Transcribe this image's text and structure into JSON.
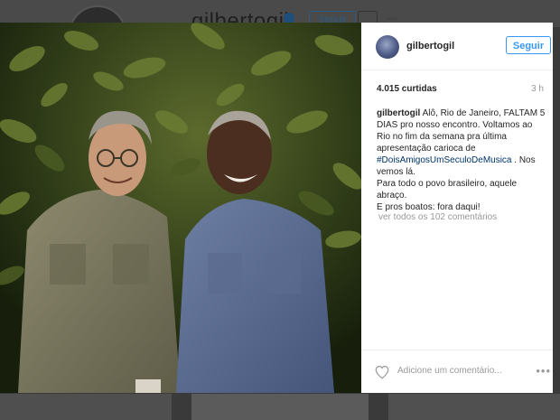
{
  "background": {
    "username": "gilbertogil",
    "follow_label": "Seguir",
    "more_dots": "•••"
  },
  "post": {
    "username": "gilbertogil",
    "follow_label": "Seguir",
    "likes": "4.015 curtidas",
    "time": "3 h",
    "caption": {
      "author": "gilbertogil",
      "text_before_tag": " Alô, Rio de Janeiro, FALTAM 5 DIAS pro nosso encontro. Voltamos ao Rio no fim da semana pra última apresentação carioca de ",
      "hashtag": "#DoisAmigosUmSeculoDeMusica",
      "text_after_tag": " . Nos vemos lá.",
      "line2": "Para todo o povo brasileiro, aquele abraço.",
      "line3": "E pros boatos: fora daqui!"
    },
    "view_all_comments": "ver todos os 102 comentários",
    "comment_placeholder": "Adicione um comentário...",
    "more_options": "•••"
  },
  "icons": {
    "verified": "verified-badge-icon",
    "heart": "heart-icon",
    "more": "more-options-icon"
  },
  "colors": {
    "accent": "#3897f0",
    "hashtag": "#003569",
    "muted": "#999999",
    "text": "#262626"
  }
}
